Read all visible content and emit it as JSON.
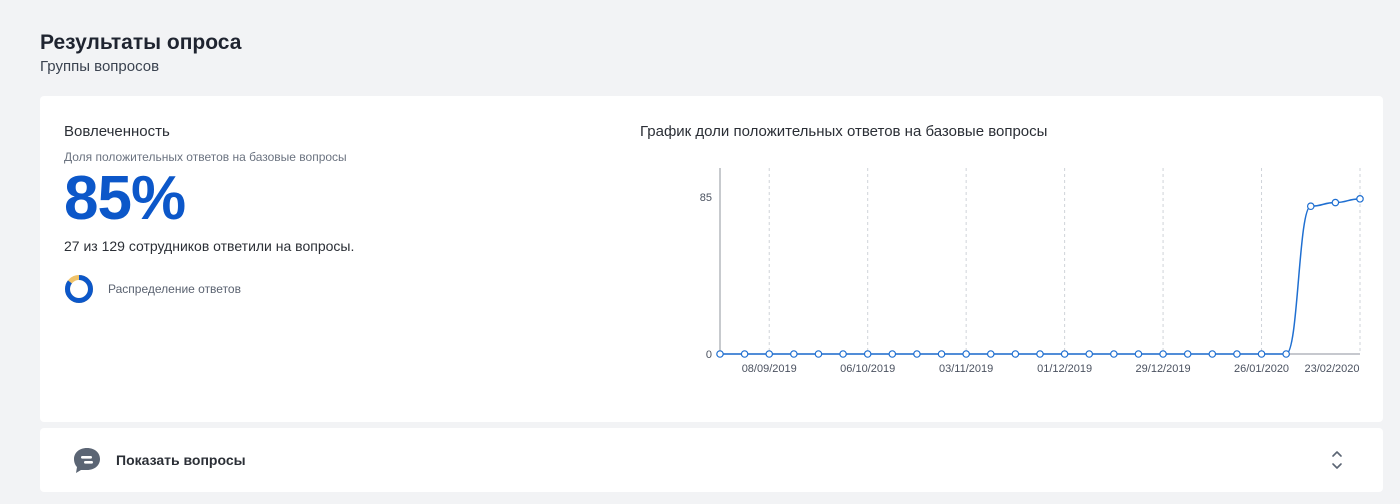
{
  "header": {
    "title": "Результаты опроса",
    "subtitle": "Группы вопросов"
  },
  "engagement": {
    "title": "Вовлеченность",
    "subtitle": "Доля положительных ответов на базовые вопросы",
    "value": "85%",
    "description": "27 из 129 сотрудников ответили на вопросы.",
    "distribution_label": "Распределение ответов",
    "distribution_icon": "donut-chart-icon",
    "donut": {
      "main_fraction": 0.85,
      "main_color": "#0c57c9",
      "rest_color": "#f0c36a"
    }
  },
  "chart_title": "График доли положительных ответов на базовые вопросы",
  "chart_data": {
    "type": "line",
    "ylim": [
      0,
      85
    ],
    "y_ticks": [
      0,
      85
    ],
    "x_tick_labels": [
      "08/09/2019",
      "06/10/2019",
      "03/11/2019",
      "01/12/2019",
      "29/12/2019",
      "26/01/2020",
      "23/02/2020"
    ],
    "series": [
      {
        "values": [
          0,
          0,
          0,
          0,
          0,
          0,
          0,
          0,
          0,
          0,
          0,
          0,
          0,
          0,
          0,
          0,
          0,
          0,
          0,
          0,
          0,
          0,
          0,
          0,
          80,
          82,
          84
        ]
      }
    ],
    "line_color": "#1f6fd1",
    "grid": "vertical-dashed"
  },
  "footer": {
    "questions_label": "Показать вопросы",
    "questions_icon": "chat-bubble-icon",
    "expand_icon": "chevron-up-down-icon"
  }
}
